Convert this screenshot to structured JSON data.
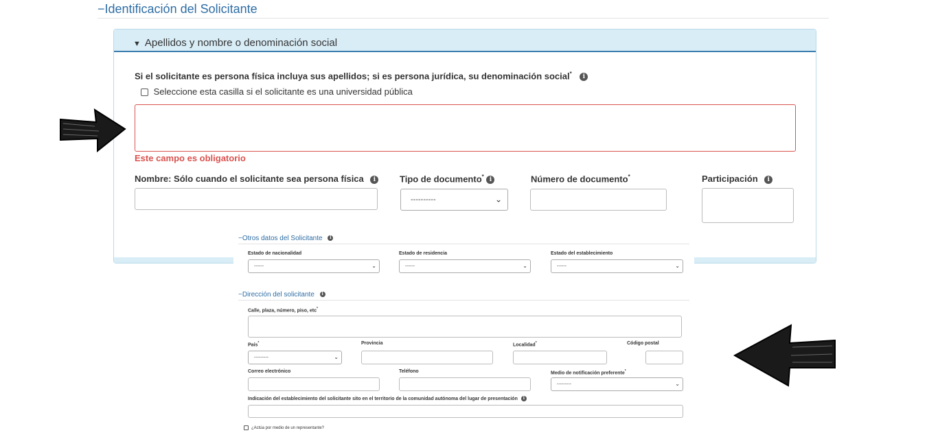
{
  "header": {
    "collapse_symbol": "−",
    "title": "Identificación del Solicitante"
  },
  "panel": {
    "title": "Apellidos y nombre o denominación social",
    "question": "Si el solicitante es persona física incluya sus apellidos; si es persona jurídica, su denominación social",
    "required_mark": "*",
    "university_checkbox_label": "Seleccione esta casilla si el solicitante es una universidad pública",
    "surname_value": "",
    "error_text": "Este campo es obligatorio",
    "nombre_label": "Nombre: Sólo cuando el solicitante sea persona física",
    "tipo_documento_label": "Tipo de documento",
    "tipo_documento_value": "----------",
    "numero_documento_label": "Número de documento",
    "participacion_label": "Participación"
  },
  "otros": {
    "collapse_symbol": "−",
    "title": "Otros datos del Solicitante",
    "nacionalidad_label": "Estado de nacionalidad",
    "nacionalidad_value": "------",
    "residencia_label": "Estado de residencia",
    "residencia_value": "------",
    "establecimiento_label": "Estado del establecimiento",
    "establecimiento_value": "------"
  },
  "direccion": {
    "collapse_symbol": "−",
    "title": "Dirección del solicitante",
    "calle_label": "Calle, plaza, número, piso, etc",
    "pais_label": "País",
    "pais_value": "---------",
    "provincia_label": "Provincia",
    "localidad_label": "Localidad",
    "codigo_postal_label": "Código postal",
    "correo_label": "Correo electrónico",
    "telefono_label": "Teléfono",
    "medio_label": "Medio de notificación preferente",
    "medio_value": "---------",
    "indicacion_label": "Indicación del establecimiento del solicitante sito en el territorio de la comunidad autónoma del lugar de presentación"
  },
  "representante": {
    "label": "¿Actúa por medio de un representante?"
  },
  "icons": {
    "info": "info-icon",
    "chevron": "chevron-down-icon",
    "caret": "caret-down-icon",
    "arrow_right": "hand-drawn-arrow-right",
    "arrow_left": "hand-drawn-arrow-left"
  },
  "colors": {
    "link_blue": "#2e6da4",
    "error_red": "#d9534f",
    "panel_header_bg": "#d9edf7",
    "panel_border": "#b9dbe9"
  }
}
